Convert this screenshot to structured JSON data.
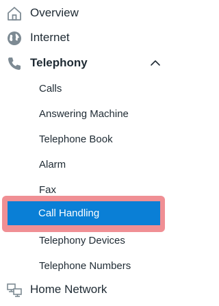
{
  "nav": {
    "overview": {
      "label": "Overview",
      "icon": "home-icon"
    },
    "internet": {
      "label": "Internet",
      "icon": "globe-icon"
    },
    "telephony": {
      "label": "Telephony",
      "icon": "phone-icon",
      "expanded": true,
      "children": [
        {
          "label": "Calls"
        },
        {
          "label": "Answering Machine"
        },
        {
          "label": "Telephone Book"
        },
        {
          "label": "Alarm"
        },
        {
          "label": "Fax"
        },
        {
          "label": "Call Handling",
          "active": true
        },
        {
          "label": "Telephony Devices"
        },
        {
          "label": "Telephone Numbers"
        }
      ]
    },
    "home_network": {
      "label": "Home Network",
      "icon": "network-icon"
    }
  },
  "colors": {
    "text": "#1e2a33",
    "icon": "#7d8a93",
    "active_bg": "#0a7fd6",
    "active_text": "#ffffff",
    "highlight_border": "#f08f94"
  }
}
